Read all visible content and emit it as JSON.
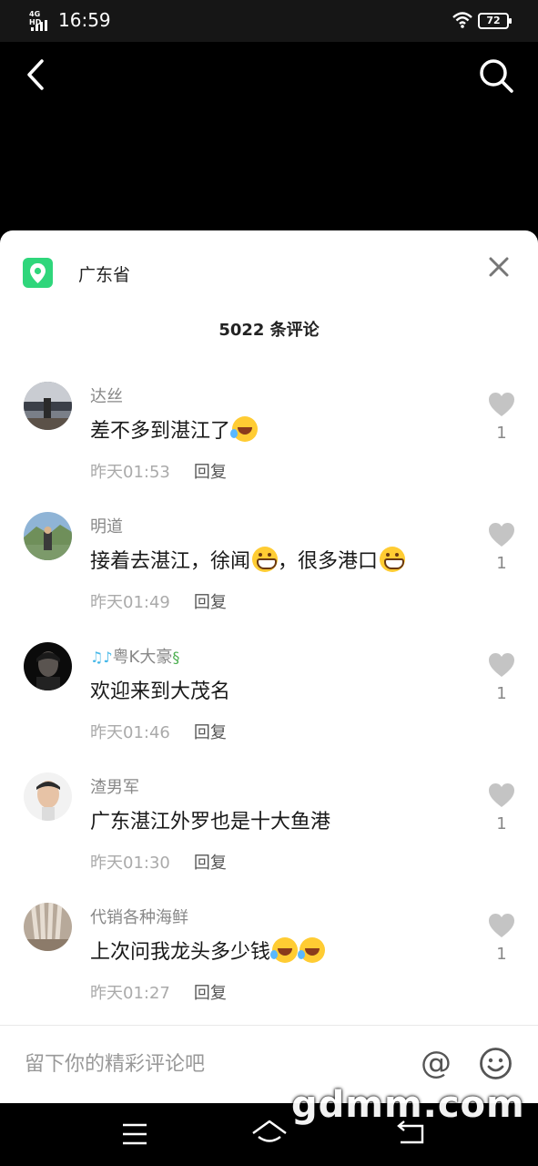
{
  "status_bar": {
    "network": "4G HD",
    "time": "16:59",
    "battery": "72"
  },
  "header": {
    "back_icon": "chevron-left-icon",
    "search_icon": "search-icon"
  },
  "sheet": {
    "location": "广东省",
    "location_color": "#2fd67b",
    "comment_count": "5022 条评论",
    "close_icon": "close-icon"
  },
  "comments": [
    {
      "username": "达丝",
      "text": "差不多到湛江了",
      "emojis": [
        "laugh"
      ],
      "time": "昨天01:53",
      "reply": "回复",
      "likes": "1"
    },
    {
      "username": "明道",
      "text_parts": [
        "接着去湛江，徐闻",
        "，很多港口"
      ],
      "emojis": [
        "grin",
        "grin"
      ],
      "time": "昨天01:49",
      "reply": "回复",
      "likes": "1"
    },
    {
      "username": "粤K大豪",
      "text": "欢迎来到大茂名",
      "time": "昨天01:46",
      "reply": "回复",
      "likes": "1"
    },
    {
      "username": "渣男军",
      "text": "广东湛江外罗也是十大鱼港",
      "time": "昨天01:30",
      "reply": "回复",
      "likes": "1"
    },
    {
      "username": "代销各种海鲜",
      "text": "上次问我龙头多少钱",
      "emojis": [
        "laugh",
        "laugh"
      ],
      "time": "昨天01:27",
      "reply": "回复",
      "likes": "1"
    }
  ],
  "input": {
    "placeholder": "留下你的精彩评论吧",
    "at_label": "@",
    "emoji_icon": "smiley-icon"
  },
  "watermark": "gdmm.com",
  "colors": {
    "background": "#000000",
    "sheet": "#ffffff",
    "accent": "#2fd67b",
    "muted_text": "#888888"
  }
}
